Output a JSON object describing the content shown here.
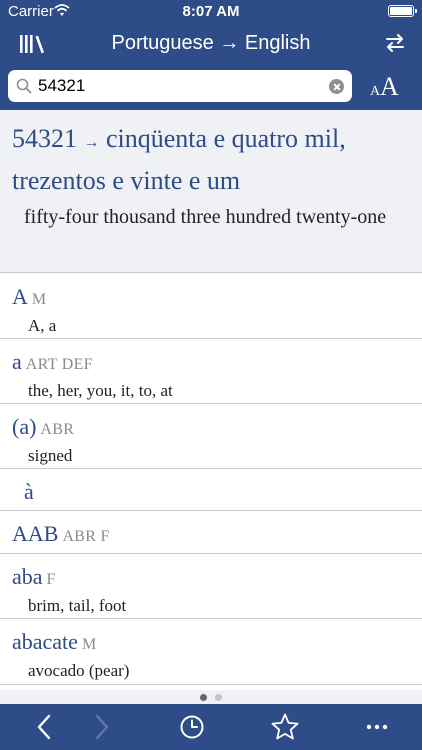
{
  "status": {
    "carrier": "Carrier",
    "time": "8:07 AM"
  },
  "nav": {
    "title": "Portuguese → English",
    "left_icon": "library-icon",
    "right_icon": "swap-icon"
  },
  "search": {
    "value": "54321",
    "placeholder": ""
  },
  "fontsize": {
    "small": "A",
    "large": "A"
  },
  "main_entry": {
    "headword": "54321",
    "arrow": "→",
    "text": "cinqüenta e quatro mil, trezentos e vinte e um",
    "translation": "fifty-four thousand three hundred twenty-one"
  },
  "results": [
    {
      "word": "A",
      "pos": "M",
      "translation": "A, a"
    },
    {
      "word": "a",
      "pos": "ART DEF",
      "translation": "the, her, you, it, to, at"
    },
    {
      "word": "(a)",
      "pos": "ABR",
      "translation": "signed"
    },
    {
      "word": "à",
      "pos": "",
      "translation": ""
    },
    {
      "word": "AAB",
      "pos": "ABR F",
      "translation": ""
    },
    {
      "word": "aba",
      "pos": "F",
      "translation": "brim, tail, foot"
    },
    {
      "word": "abacate",
      "pos": "M",
      "translation": "avocado (pear)"
    }
  ],
  "pager": {
    "pages": 2,
    "current": 1
  },
  "toolbar": {
    "icons": [
      "back-icon",
      "forward-icon",
      "history-icon",
      "favorites-icon",
      "more-icon"
    ]
  },
  "colors": {
    "brand": "#2e4c87",
    "entry_bg": "#f0f1f5",
    "pos_gray": "#8a8a8a"
  }
}
